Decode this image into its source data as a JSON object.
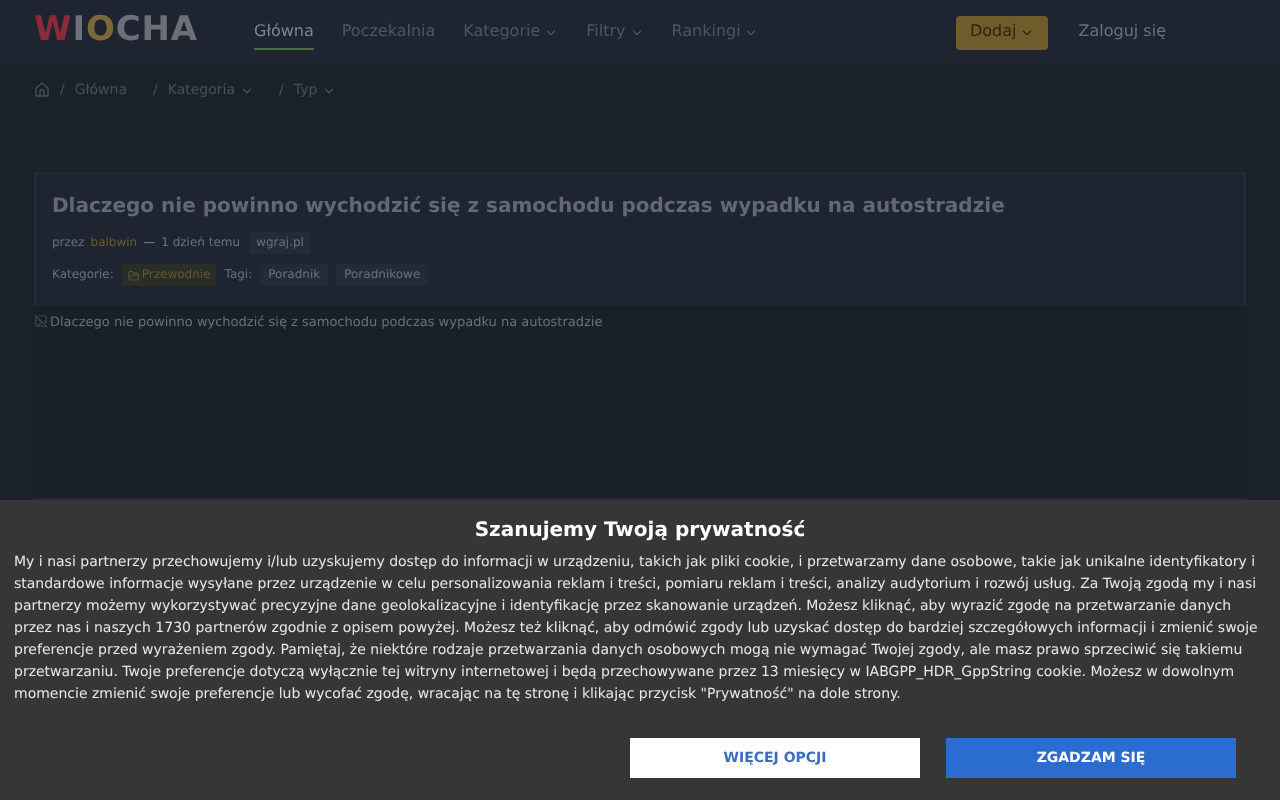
{
  "logo": {
    "first": "W",
    "rest": "I",
    "o": "O",
    "tail": "CHA"
  },
  "nav": [
    {
      "label": "Główna",
      "selected": true,
      "dropdown": false
    },
    {
      "label": "Poczekalnia",
      "selected": false,
      "dropdown": false
    },
    {
      "label": "Kategorie",
      "selected": false,
      "dropdown": true
    },
    {
      "label": "Filtry",
      "selected": false,
      "dropdown": true
    },
    {
      "label": "Rankingi",
      "selected": false,
      "dropdown": true
    }
  ],
  "add_button": "Dodaj",
  "login": "Zaloguj się",
  "breadcrumb": [
    {
      "separator": "/",
      "label": "Główna",
      "dropdown": false
    },
    {
      "separator": "/",
      "label": "Kategoria",
      "dropdown": true
    },
    {
      "separator": "/",
      "label": "Typ",
      "dropdown": true
    }
  ],
  "article": {
    "title": "Dlaczego nie powinno wychodzić się z samochodu podczas wypadku na autostradzie",
    "by": "przez",
    "author": "balbwin",
    "separator": "—",
    "time": "1 dzień temu",
    "source": "wgraj.pl",
    "categories_label": "Kategorie:",
    "category": "Przewodnie",
    "tags_label": "Tagi:",
    "tags": [
      "Poradnik",
      "Poradnikowe"
    ],
    "image_alt": "Dlaczego nie powinno wychodzić się z samochodu podczas wypadku na autostradzie"
  },
  "consent": {
    "title": "Szanujemy Twoją prywatność",
    "text": "My i nasi partnerzy przechowujemy i/lub uzyskujemy dostęp do informacji w urządzeniu, takich jak pliki cookie, i przetwarzamy dane osobowe, takie jak unikalne identyfikatory i standardowe informacje wysyłane przez urządzenie w celu personalizowania reklam i treści, pomiaru reklam i treści, analizy audytorium i rozwój usług. Za Twoją zgodą my i nasi partnerzy możemy wykorzystywać precyzyjne dane geolokalizacyjne i identyfikację przez skanowanie urządzeń. Możesz kliknąć, aby wyrazić zgodę na przetwarzanie danych przez nas i naszych 1730 partnerów zgodnie z opisem powyżej. Możesz też kliknąć, aby odmówić zgody lub uzyskać dostęp do bardziej szczegółowych informacji i zmienić swoje preferencje przed wyrażeniem zgody. Pamiętaj, że niektóre rodzaje przetwarzania danych osobowych mogą nie wymagać Twojej zgody, ale masz prawo sprzeciwić się takiemu przetwarzaniu. Twoje preferencje dotyczą wyłącznie tej witryny internetowej i będą przechowywane przez 13 miesięcy w IABGPP_HDR_GppString cookie. Możesz w dowolnym momencie zmienić swoje preferencje lub wycofać zgodę, wracając na tę stronę i klikając przycisk \"Prywatność\" na dole strony.",
    "more_button": "WIĘCEJ OPCJI",
    "accept_button": "ZGADZAM SIĘ"
  }
}
